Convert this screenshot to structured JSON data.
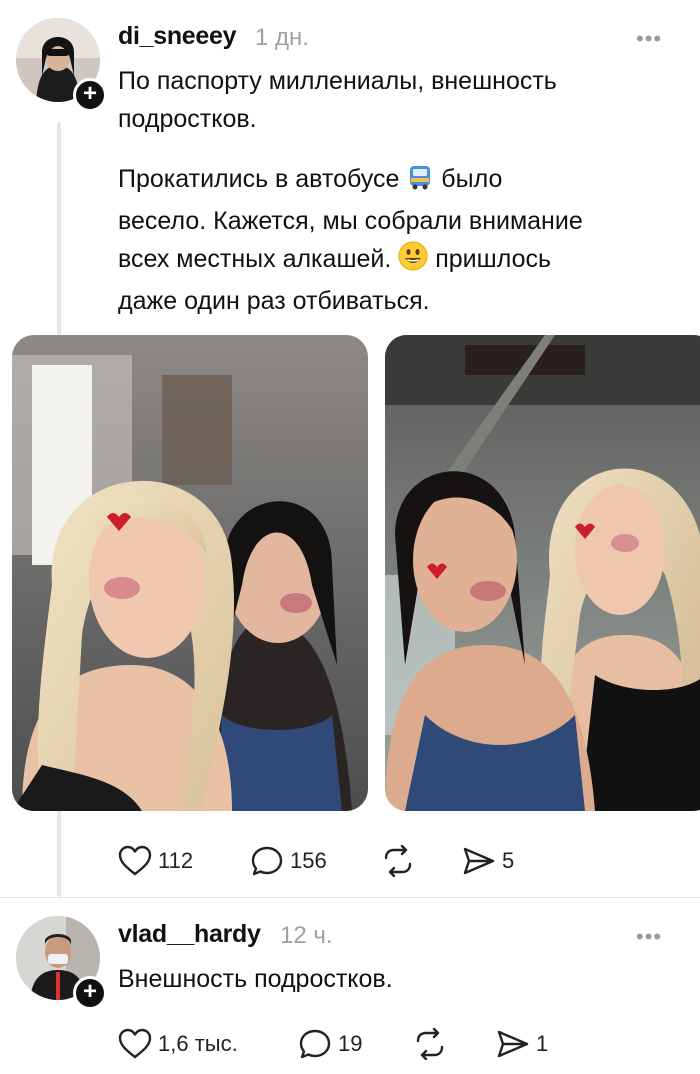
{
  "post1": {
    "username": "di_sneeey",
    "time": "1 дн.",
    "more": "•••",
    "avatar": "avatar-photo",
    "paragraph1": "По паспорту миллениалы, внешность подростков.",
    "paragraph2_line1_a": "Прокатились в автобусе",
    "paragraph2_line1_b": "было",
    "paragraph2_line2": "весело. Кажется, мы собрали внимание",
    "paragraph2_line3_a": "всех местных алкашей.",
    "paragraph2_line3_b": "пришлось",
    "paragraph2_line4": "даже один раз отбиваться.",
    "emoji_bus": "bus-icon",
    "emoji_grin": "grinning-face-icon",
    "photos": [
      "photo-left",
      "photo-right"
    ],
    "likes": "112",
    "comments": "156",
    "shares": "5"
  },
  "post2": {
    "username": "vlad__hardy",
    "time": "12 ч.",
    "more": "•••",
    "avatar": "avatar-photo",
    "text": "Внешность подростков.",
    "likes": "1,6 тыс.",
    "comments": "19",
    "shares": "1"
  },
  "icons": {
    "like": "heart-icon",
    "comment": "comment-bubble-icon",
    "repost": "repost-icon",
    "share": "send-icon",
    "follow": "plus-icon"
  },
  "colors": {
    "text": "#111111",
    "muted": "#a0a0a0",
    "thread": "#e6e6e6"
  }
}
